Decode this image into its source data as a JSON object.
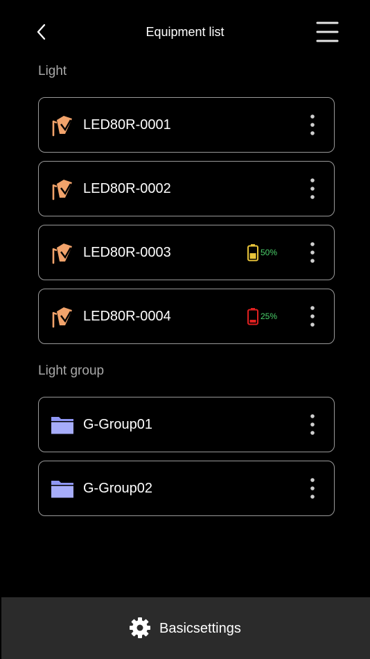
{
  "header": {
    "title": "Equipment list",
    "back_icon": "chevron-left-icon",
    "menu_icon": "hamburger-menu-icon"
  },
  "sections": {
    "light_label": "Light",
    "group_label": "Light group"
  },
  "lights": [
    {
      "name": "LED80R-0001",
      "battery": null
    },
    {
      "name": "LED80R-0002",
      "battery": null
    },
    {
      "name": "LED80R-0003",
      "battery": "50%",
      "battery_color": "#e8c43a",
      "battery_text_color": "#4bd16b"
    },
    {
      "name": "LED80R-0004",
      "battery": "25%",
      "battery_color": "#e02020",
      "battery_text_color": "#4bd16b"
    }
  ],
  "groups": [
    {
      "name": "G-Group01"
    },
    {
      "name": "G-Group02"
    }
  ],
  "footer": {
    "label": "Basicsettings",
    "icon": "gear-icon"
  },
  "colors": {
    "light_icon": "#f2a36b",
    "folder_icon": "#8f97f5",
    "card_border": "#9a9a9a",
    "bottom_bar": "#2b2b2b"
  }
}
